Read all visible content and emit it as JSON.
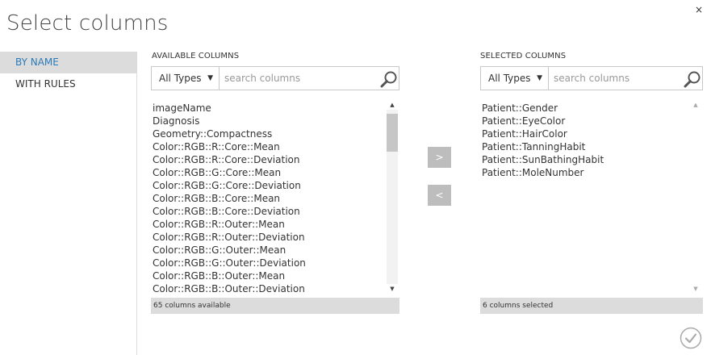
{
  "dialog": {
    "title": "Select columns",
    "close_glyph": "×"
  },
  "nav": {
    "items": [
      {
        "label": "BY NAME",
        "active": true
      },
      {
        "label": "WITH RULES",
        "active": false
      }
    ]
  },
  "available": {
    "label": "AVAILABLE COLUMNS",
    "type_filter": "All Types",
    "search_placeholder": "search columns",
    "items": [
      "imageName",
      "Diagnosis",
      "Geometry::Compactness",
      "Color::RGB::R::Core::Mean",
      "Color::RGB::R::Core::Deviation",
      "Color::RGB::G::Core::Mean",
      "Color::RGB::G::Core::Deviation",
      "Color::RGB::B::Core::Mean",
      "Color::RGB::B::Core::Deviation",
      "Color::RGB::R::Outer::Mean",
      "Color::RGB::R::Outer::Deviation",
      "Color::RGB::G::Outer::Mean",
      "Color::RGB::G::Outer::Deviation",
      "Color::RGB::B::Outer::Mean",
      "Color::RGB::B::Outer::Deviation"
    ],
    "status": "65 columns available"
  },
  "selected": {
    "label": "SELECTED COLUMNS",
    "type_filter": "All Types",
    "search_placeholder": "search columns",
    "items": [
      "Patient::Gender",
      "Patient::EyeColor",
      "Patient::HairColor",
      "Patient::TanningHabit",
      "Patient::SunBathingHabit",
      "Patient::MoleNumber"
    ],
    "status": "6 columns selected"
  },
  "buttons": {
    "add": ">",
    "remove": "<"
  },
  "colors": {
    "accent": "#2b7ab8",
    "nav_active_bg": "#dcdcdc",
    "button_gray": "#bdbdbd"
  }
}
